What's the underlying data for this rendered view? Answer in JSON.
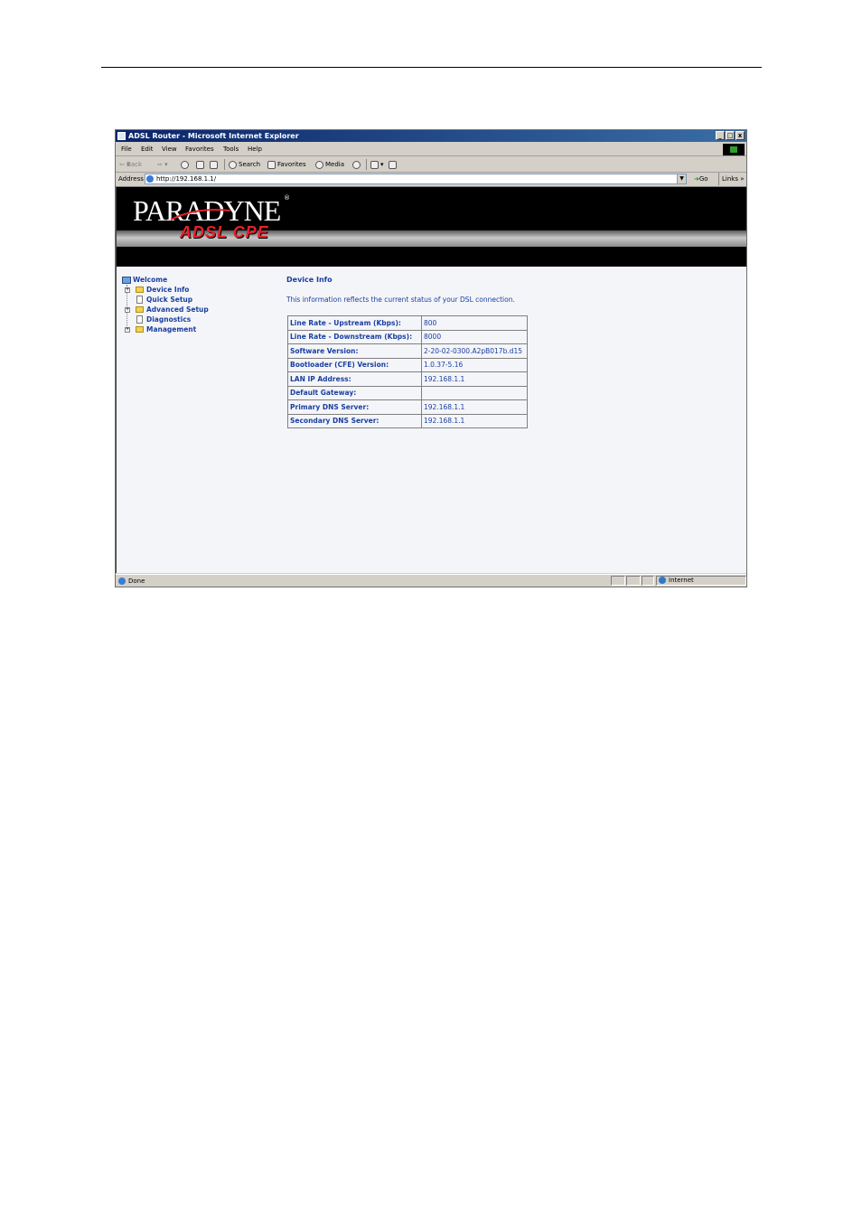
{
  "browser": {
    "title": "ADSL Router - Microsoft Internet Explorer",
    "window_buttons": [
      "_",
      "□",
      "x"
    ],
    "menu": [
      "File",
      "Edit",
      "View",
      "Favorites",
      "Tools",
      "Help"
    ],
    "toolbar": {
      "back": "Back",
      "search": "Search",
      "favorites": "Favorites",
      "media": "Media"
    },
    "address_label": "Address",
    "address_value": "http://192.168.1.1/",
    "go": "Go",
    "links": "Links",
    "status": "Done",
    "zone": "Internet"
  },
  "banner": {
    "logo": "PARADYNE",
    "registered": "®",
    "subtitle": "ADSL CPE"
  },
  "nav": {
    "items": [
      {
        "label": "Welcome"
      },
      {
        "label": "Device Info"
      },
      {
        "label": "Quick Setup"
      },
      {
        "label": "Advanced Setup"
      },
      {
        "label": "Diagnostics"
      },
      {
        "label": "Management"
      }
    ]
  },
  "content": {
    "title": "Device Info",
    "description": "This information reflects the current status of your DSL connection.",
    "rows": [
      {
        "label": "Line Rate - Upstream (Kbps):",
        "value": "800"
      },
      {
        "label": "Line Rate - Downstream (Kbps):",
        "value": "8000"
      },
      {
        "label": "Software Version:",
        "value": "2-20-02-0300.A2pB017b.d15"
      },
      {
        "label": "Bootloader (CFE) Version:",
        "value": "1.0.37-5.16"
      },
      {
        "label": "LAN IP Address:",
        "value": "192.168.1.1"
      },
      {
        "label": "Default Gateway:",
        "value": ""
      },
      {
        "label": "Primary DNS Server:",
        "value": "192.168.1.1"
      },
      {
        "label": "Secondary DNS Server:",
        "value": "192.168.1.1"
      }
    ]
  }
}
